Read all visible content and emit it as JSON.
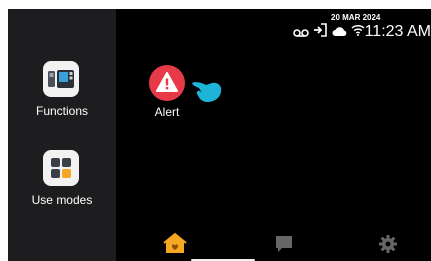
{
  "sidebar": {
    "items": [
      {
        "label": "Functions",
        "icon": "intercom-monitor-icon"
      },
      {
        "label": "Use modes",
        "icon": "grid-icon"
      }
    ]
  },
  "status": {
    "date": "20 MAR 2024",
    "time": "11:23 AM",
    "icons": [
      "voicemail-icon",
      "door-exit-icon",
      "cloud-icon",
      "wifi-icon"
    ]
  },
  "apps": [
    {
      "label": "Alert",
      "icon": "alert-triangle-icon"
    }
  ],
  "bottom_nav": {
    "items": [
      "home-icon",
      "chat-icon",
      "settings-gear-icon"
    ],
    "active": "home-icon"
  },
  "colors": {
    "accent": "#f5a623",
    "alert": "#e63a49",
    "pointer": "#1eb4d8",
    "sidebar": "#1d1d1f",
    "background": "#000000"
  }
}
